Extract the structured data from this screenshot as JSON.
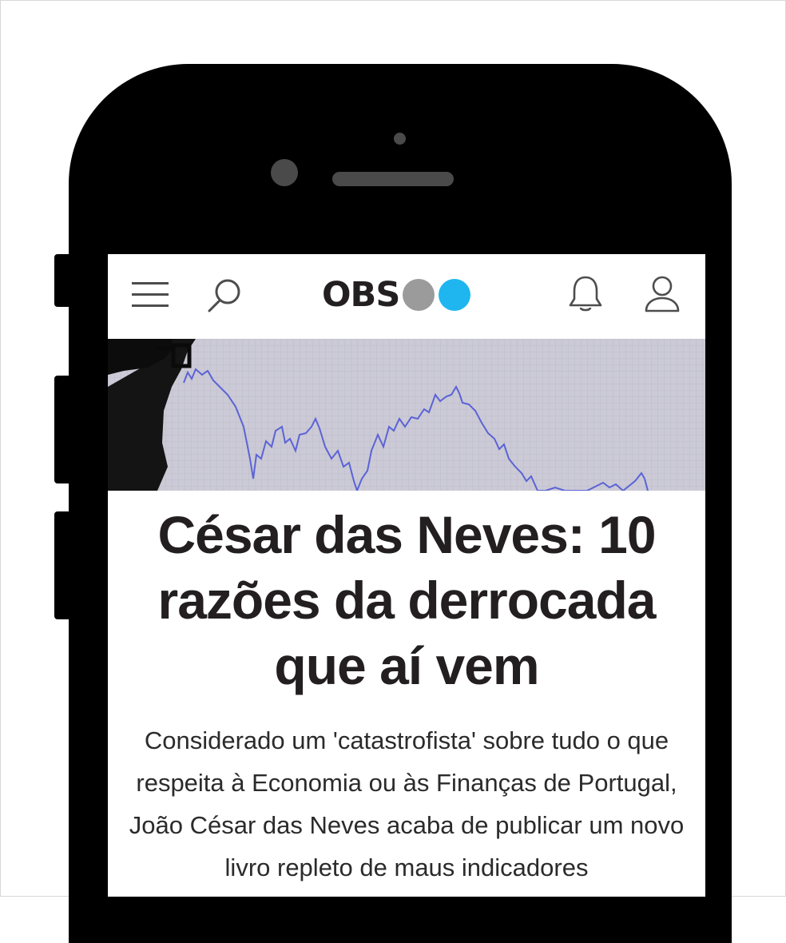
{
  "header": {
    "logo_text": "OBS",
    "logo_dot_colors": [
      "#9b9b9b",
      "#1fb6f0"
    ]
  },
  "icons": {
    "menu": "hamburger-menu-icon",
    "search": "search-icon",
    "notifications": "bell-icon",
    "account": "user-icon"
  },
  "article": {
    "headline": "César das Neves: 10 razões da derrocada que aí vem",
    "lead": "Considerado um 'catastrofista' sobre tudo o que respeita à Economia ou às Finanças de Portugal, João César das Neves acaba de publicar um novo livro repleto de maus indicadores"
  },
  "colors": {
    "text": "#231f20",
    "chart_line": "#5b63d6",
    "phone_body": "#000000"
  }
}
